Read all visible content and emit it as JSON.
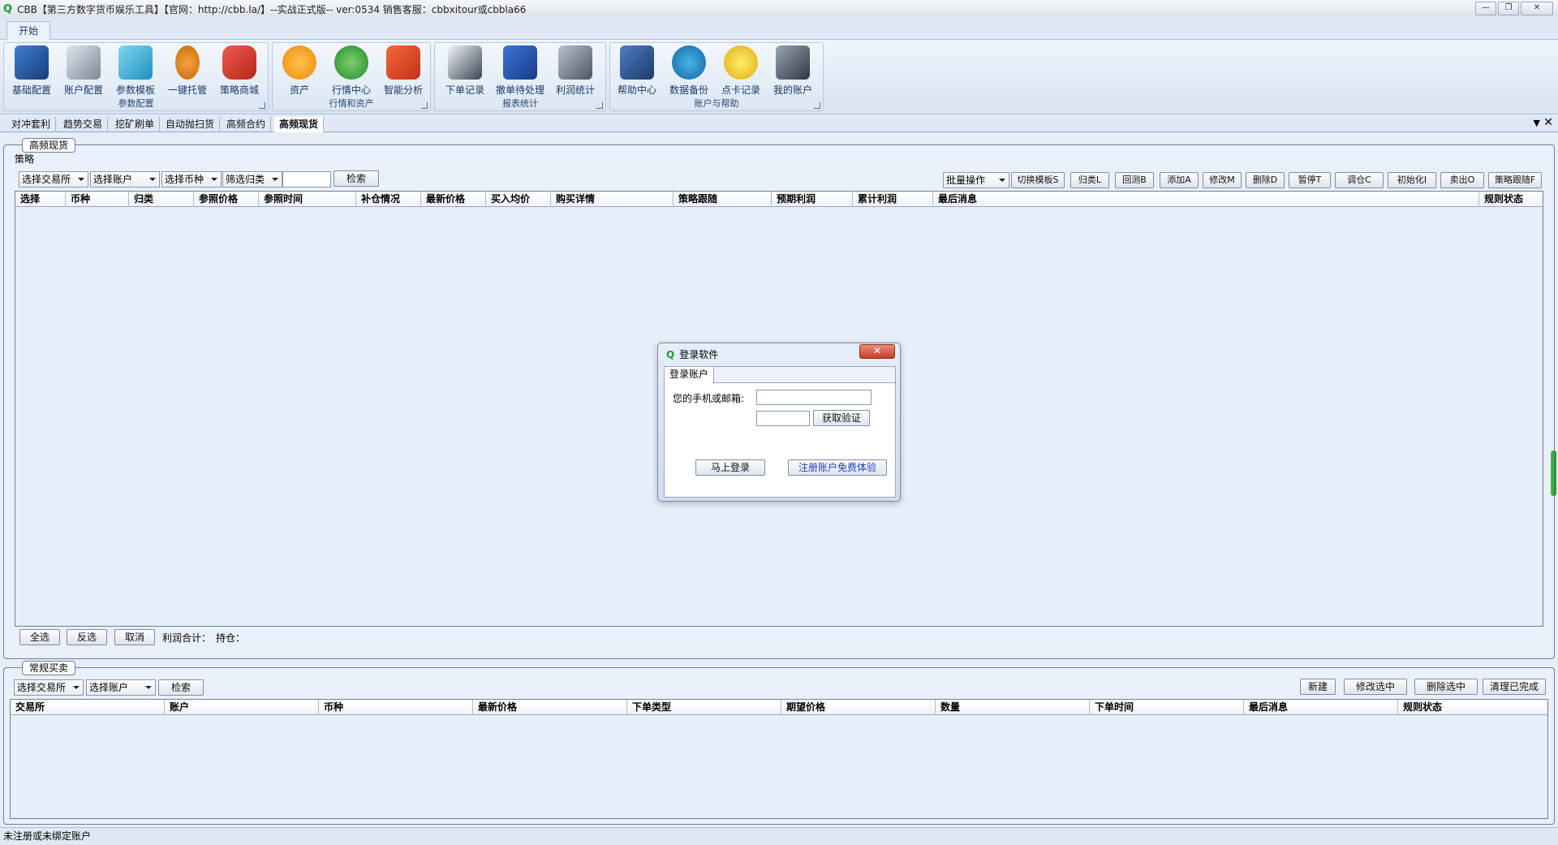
{
  "window": {
    "title": "CBB【第三方数字货币娱乐工具】【官网：http://cbb.la/】--实战正式版-- ver:0534   销售客服：cbbxitour或cbbla66",
    "controls": {
      "minimize": "—",
      "restore": "❐",
      "close": "✕"
    }
  },
  "ribbon": {
    "tab": "开始",
    "groups": [
      {
        "label": "参数配置",
        "buttons": [
          "基础配置",
          "账户配置",
          "参数模板",
          "一键托管",
          "策略商城"
        ]
      },
      {
        "label": "行情和资产",
        "buttons": [
          "资产",
          "行情中心",
          "智能分析"
        ]
      },
      {
        "label": "报表统计",
        "buttons": [
          "下单记录",
          "撤单待处理",
          "利润统计"
        ]
      },
      {
        "label": "账户与帮助",
        "buttons": [
          "帮助中心",
          "数据备份",
          "点卡记录",
          "我的账户"
        ]
      }
    ],
    "icons": [
      "toolbox-icon",
      "computer-icon",
      "tablet-icon",
      "robot-icon",
      "hexagon-shop-icon",
      "bitcoin-icon",
      "chart-up-icon",
      "analysis-icon",
      "newspaper-icon",
      "folder-icon",
      "checklist-icon",
      "help-person-icon",
      "backup-globe-icon",
      "dollar-coin-icon",
      "monitor-icon"
    ]
  },
  "module_tabs": [
    "对冲套利",
    "趋势交易",
    "挖矿刷单",
    "自动抛扫货",
    "高频合约",
    "高频现货"
  ],
  "top_panel": {
    "title": "高频现货",
    "subtab": "策略",
    "filters": [
      "选择交易所",
      "选择账户",
      "选择币种",
      "筛选归类"
    ],
    "search_button": "检索",
    "batch_combo": "批量操作",
    "action_buttons": [
      "切换模板S",
      "归类L",
      "回测B",
      "添加A",
      "修改M",
      "删除D",
      "暂停T",
      "调仓C",
      "初始化I",
      "卖出O",
      "策略跟随F"
    ],
    "columns": [
      "选择",
      "币种",
      "归类",
      "参照价格",
      "参照时间",
      "补仓情况",
      "最新价格",
      "买入均价",
      "购买详情",
      "策略跟随",
      "预期利润",
      "累计利润",
      "最后消息",
      "规则状态"
    ],
    "footer_buttons": [
      "全选",
      "反选",
      "取消"
    ],
    "profit_label": "利润合计：",
    "position_label": "持仓："
  },
  "bottom_panel": {
    "title": "常规买卖",
    "filters": [
      "选择交易所",
      "选择账户"
    ],
    "search_button": "检索",
    "action_buttons": [
      "新建",
      "修改选中",
      "删除选中",
      "清理已完成"
    ],
    "columns": [
      "交易所",
      "账户",
      "币种",
      "最新价格",
      "下单类型",
      "期望价格",
      "数量",
      "下单时间",
      "最后消息",
      "规则状态"
    ]
  },
  "statusbar": {
    "text": "未注册或未绑定账户"
  },
  "login_dialog": {
    "title": "登录软件",
    "close": "✕",
    "tab": "登录账户",
    "phone_label": "您的手机或邮箱:",
    "phone_value": "",
    "code_value": "",
    "get_code_button": "获取验证",
    "login_button": "马上登录",
    "register_button": "注册账户免费体验"
  },
  "colors": {
    "accent": "#1a9a2a",
    "link": "#1a3fb5",
    "background": "#e6edf7"
  }
}
